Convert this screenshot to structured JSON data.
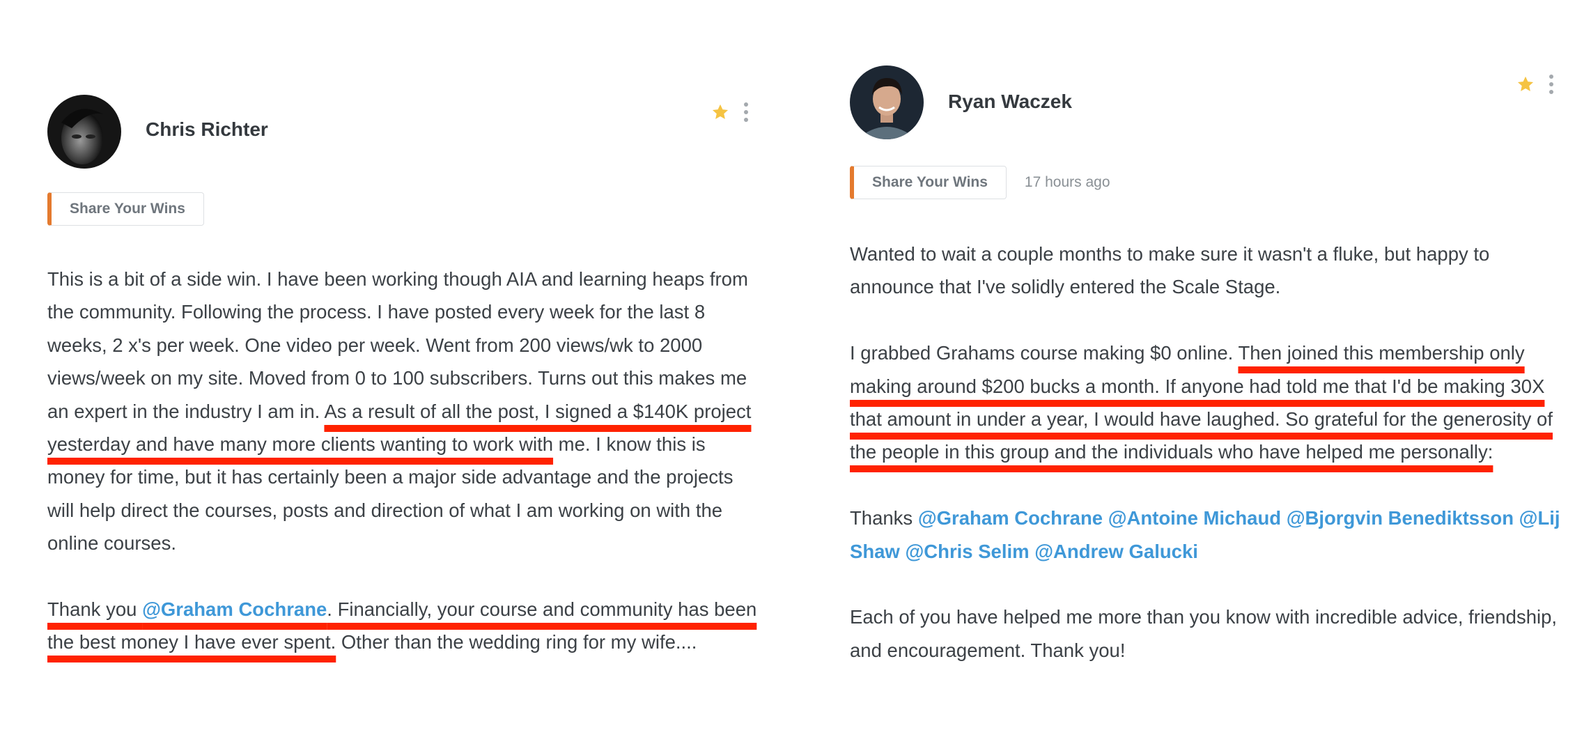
{
  "posts": [
    {
      "author": "Chris Richter",
      "tag": "Share Your Wins",
      "time": "",
      "paragraphs": [
        [
          {
            "t": "This is a bit of a side win. I have been working though AIA and learning heaps from the community. Following the process. I have posted every week for the last 8 weeks, 2 x's per week. One video per week. Went from 200 views/wk to 2000 views/week on my site. Moved from 0 to 100 subscribers. Turns out this makes me an expert in the industry I am in.  "
          },
          {
            "t": "As a result of all the post, I signed a $140K project yesterday and have many more clients wanting to work with",
            "hl": true
          },
          {
            "t": " me. I know this is money for time, but it has certainly been a major side advantage and the projects will help direct the courses, posts and direction of what I am working on with the online courses."
          }
        ],
        [
          {
            "t": "Thank you ",
            "hl": true
          },
          {
            "t": "@Graham Cochrane",
            "mention": true,
            "hl": true
          },
          {
            "t": ". Financially, your course and community has been the best money I have ever spent.",
            "hl": true
          },
          {
            "t": " Other than the wedding ring for my wife...."
          }
        ]
      ]
    },
    {
      "author": "Ryan Waczek",
      "tag": "Share Your Wins",
      "time": "17 hours ago",
      "paragraphs": [
        [
          {
            "t": "Wanted to wait a couple months to make sure it wasn't a fluke, but happy to announce that I've solidly entered the Scale Stage."
          }
        ],
        [
          {
            "t": "I grabbed Grahams course making $0 online. "
          },
          {
            "t": "Then joined this membership only making around $200 bucks a month. If anyone had told me that I'd be making 30X that amount in under a year, I would have laughed. So grateful for the generosity of the people in this group and the individuals who have helped me personally:",
            "hl": true
          }
        ],
        [
          {
            "t": "Thanks "
          },
          {
            "t": "@Graham Cochrane",
            "mention": true
          },
          {
            "t": " "
          },
          {
            "t": "@Antoine Michaud",
            "mention": true
          },
          {
            "t": " "
          },
          {
            "t": "@Bjorgvin Benediktsson",
            "mention": true
          },
          {
            "t": " "
          },
          {
            "t": "@Lij Shaw",
            "mention": true
          },
          {
            "t": " "
          },
          {
            "t": "@Chris Selim",
            "mention": true
          },
          {
            "t": " "
          },
          {
            "t": "@Andrew Galucki",
            "mention": true
          }
        ],
        [
          {
            "t": "Each of you have helped me more than you know with incredible advice, friendship, and encouragement. Thank you!"
          }
        ]
      ]
    }
  ],
  "colors": {
    "mention": "#3f98d8",
    "highlight_underline": "#ff2200",
    "tag_accent": "#e47a2e",
    "star": "#f5c342"
  },
  "icons": [
    "star-icon",
    "kebab-menu-icon"
  ]
}
